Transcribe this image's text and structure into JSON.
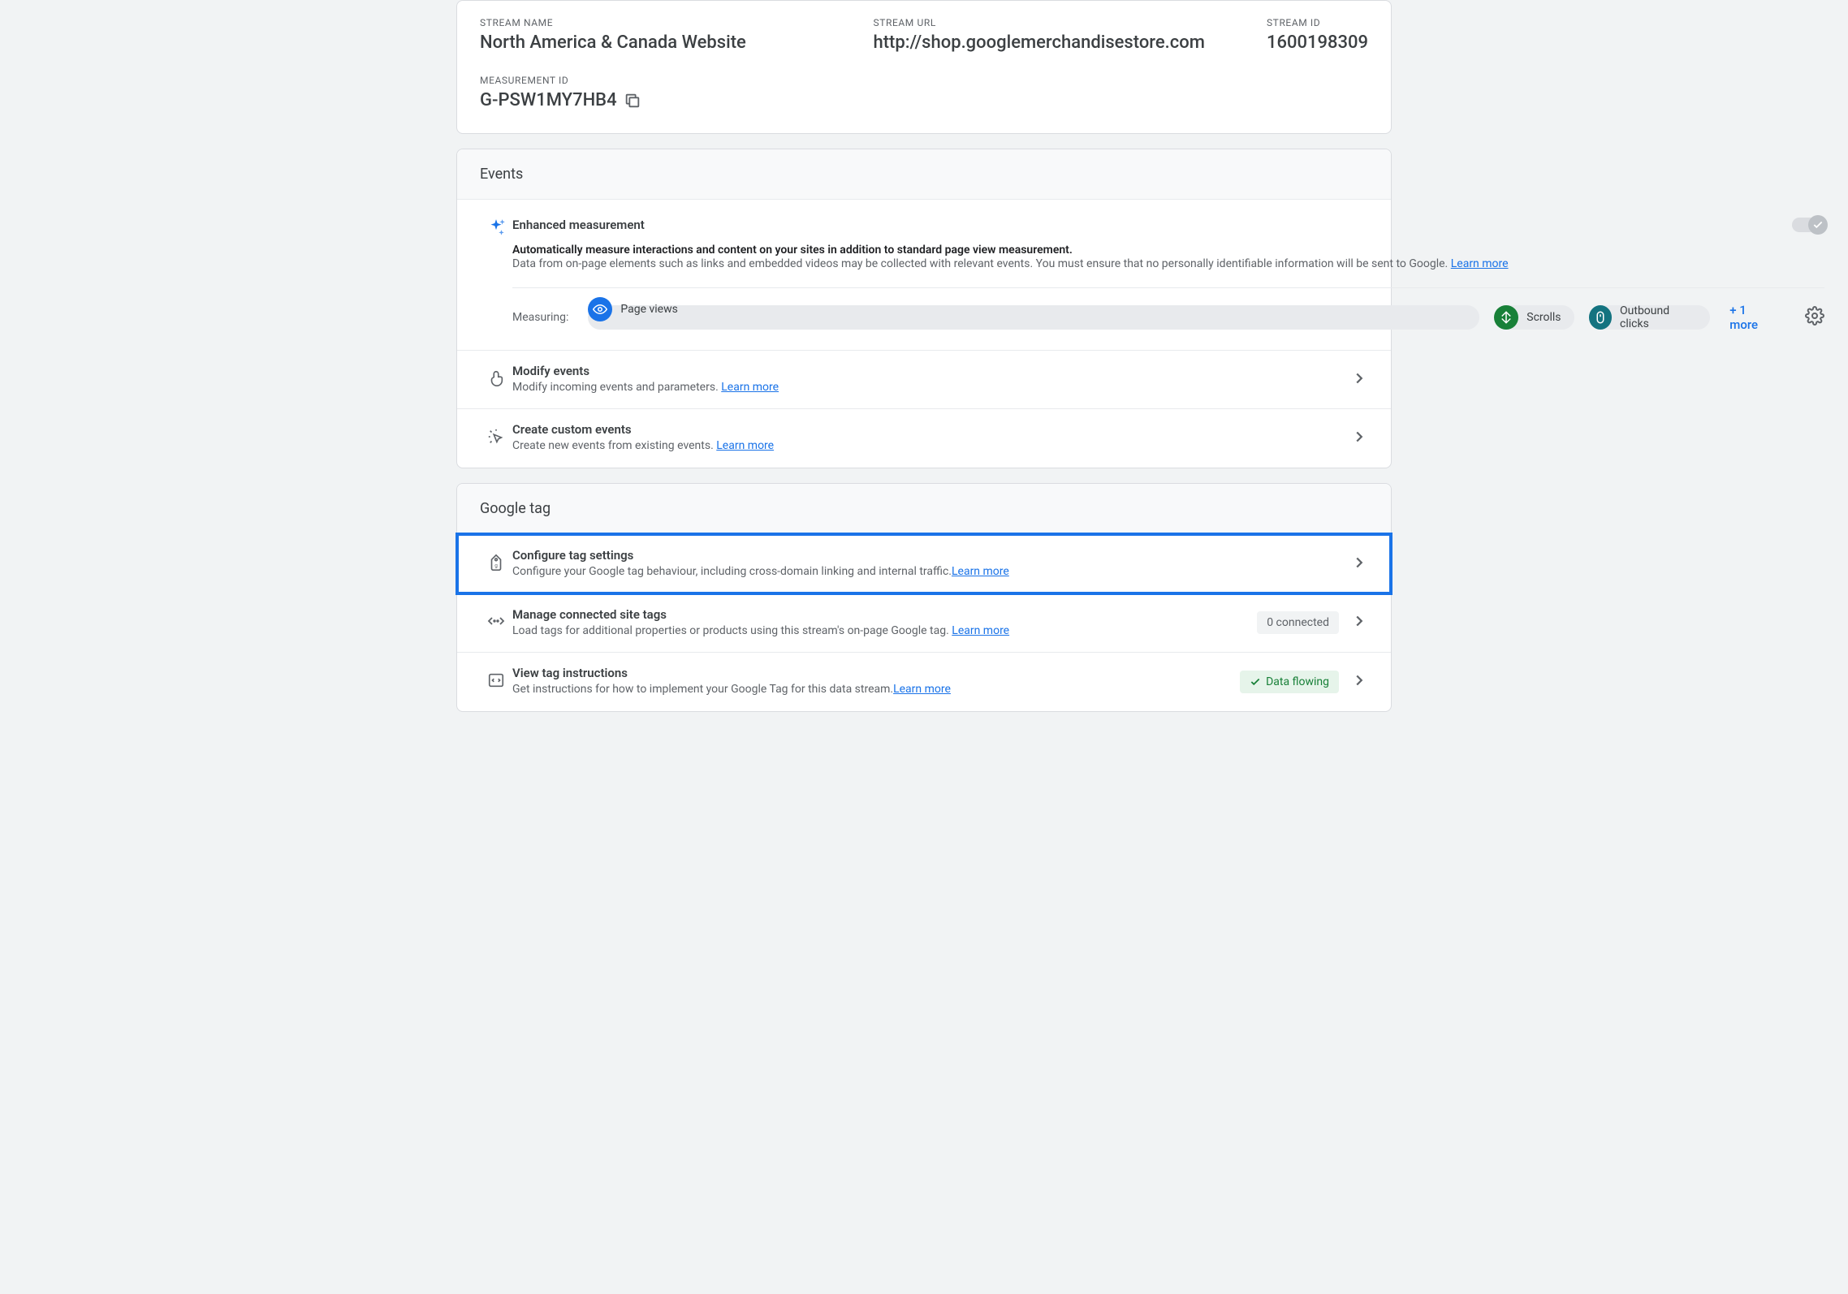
{
  "stream": {
    "name_label": "STREAM NAME",
    "name_value": "North America & Canada Website",
    "url_label": "STREAM URL",
    "url_value": "http://shop.googlemerchandisestore.com",
    "id_label": "STREAM ID",
    "id_value": "1600198309",
    "measurement_label": "MEASUREMENT ID",
    "measurement_value": "G-PSW1MY7HB4"
  },
  "events": {
    "section_title": "Events",
    "enhanced": {
      "title": "Enhanced measurement",
      "intro": "Automatically measure interactions and content on your sites in addition to standard page view measurement.",
      "detail": "Data from on-page elements such as links and embedded videos may be collected with relevant events. You must ensure that no personally identifiable information will be sent to Google.",
      "learn": "Learn more",
      "measuring_label": "Measuring:",
      "more_link": "+ 1 more",
      "chips": [
        {
          "label": "Page views"
        },
        {
          "label": "Scrolls"
        },
        {
          "label": "Outbound clicks"
        }
      ]
    },
    "modify": {
      "title": "Modify events",
      "desc": "Modify incoming events and parameters. ",
      "learn": "Learn more"
    },
    "custom": {
      "title": "Create custom events",
      "desc": "Create new events from existing events. ",
      "learn": "Learn more"
    }
  },
  "google_tag": {
    "section_title": "Google tag",
    "configure": {
      "title": "Configure tag settings",
      "desc": "Configure your Google tag behaviour, including cross-domain linking and internal traffic.",
      "learn": "Learn more"
    },
    "connected": {
      "title": "Manage connected site tags",
      "desc": "Load tags for additional properties or products using this stream's on-page Google tag. ",
      "learn": "Learn more",
      "badge": "0 connected"
    },
    "instructions": {
      "title": "View tag instructions",
      "desc": "Get instructions for how to implement your Google Tag for this data stream.",
      "learn": "Learn more",
      "badge": "Data flowing"
    }
  }
}
